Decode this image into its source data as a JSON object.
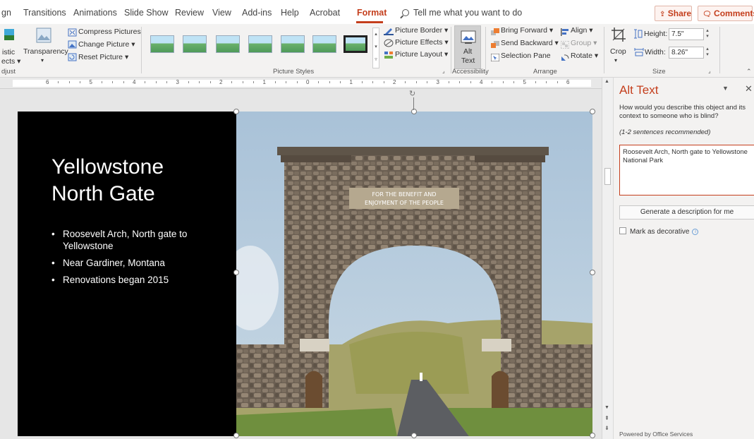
{
  "tabs": [
    {
      "label": "gn"
    },
    {
      "label": "Transitions"
    },
    {
      "label": "Animations"
    },
    {
      "label": "Slide Show"
    },
    {
      "label": "Review"
    },
    {
      "label": "View"
    },
    {
      "label": "Add-ins"
    },
    {
      "label": "Help"
    },
    {
      "label": "Acrobat"
    },
    {
      "label": "Format"
    }
  ],
  "tell_me": "Tell me what you want to do",
  "share_label": "Share",
  "comments_label": "Comments",
  "ribbon": {
    "artistic_effects_line1": "istic",
    "artistic_effects_line2": "ects ▾",
    "transparency_label": "Transparency",
    "transparency_arrow": "▾",
    "compress_pictures": "Compress Pictures",
    "change_picture": "Change Picture ▾",
    "reset_picture": "Reset Picture ▾",
    "adjust_group": "djust",
    "picture_styles_group": "Picture Styles",
    "picture_border": "Picture Border ▾",
    "picture_effects": "Picture Effects ▾",
    "picture_layout": "Picture Layout ▾",
    "alt_text_line1": "Alt",
    "alt_text_line2": "Text",
    "accessibility_group": "Accessibility",
    "bring_forward": "Bring Forward ▾",
    "send_backward": "Send Backward ▾",
    "selection_pane": "Selection Pane",
    "align": "Align ▾",
    "group": "Group ▾",
    "rotate": "Rotate ▾",
    "arrange_group": "Arrange",
    "crop_label": "Crop",
    "height_label": "Height:",
    "height_value": "7.5\"",
    "width_label": "Width:",
    "width_value": "8.26\"",
    "size_group": "Size"
  },
  "ruler_numbers": [
    "6",
    "5",
    "4",
    "3",
    "2",
    "1",
    "0",
    "1",
    "2",
    "3",
    "4",
    "5",
    "6"
  ],
  "slide": {
    "title_line1": "Yellowstone",
    "title_line2": "North Gate",
    "bullets": [
      "Roosevelt Arch, North gate to Yellowstone",
      "Near Gardiner, Montana",
      "Renovations began 2015"
    ],
    "arch_inscription_line1": "FOR THE BENEFIT AND",
    "arch_inscription_line2": "ENJOYMENT OF THE PEOPLE"
  },
  "pane": {
    "title": "Alt Text",
    "description": "How would you describe this object and its context to someone who is blind?",
    "recommendation": "(1-2 sentences recommended)",
    "alt_text_value": "Roosevelt Arch, North gate to Yellowstone National Park",
    "generate_button": "Generate a description for me",
    "mark_decorative": "Mark as decorative",
    "footer": "Powered by Office Services"
  }
}
